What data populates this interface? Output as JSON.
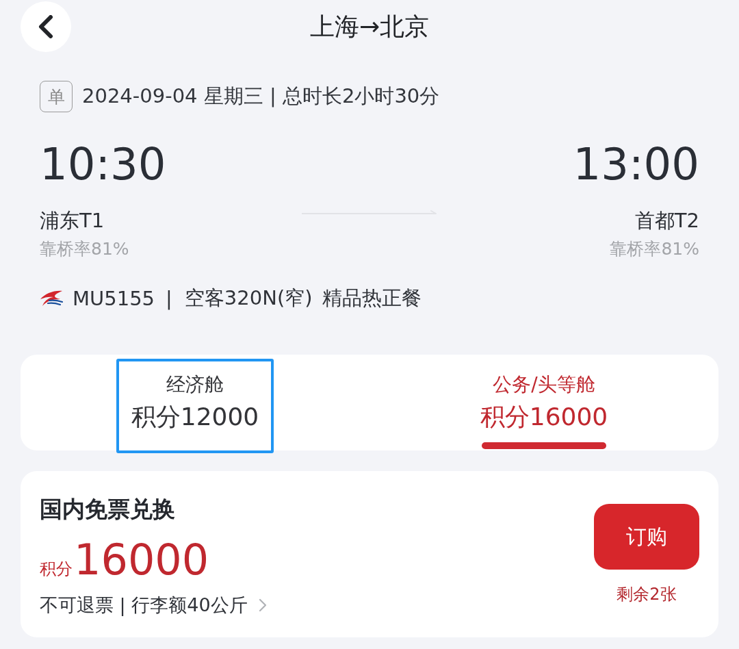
{
  "header": {
    "title": "上海→北京"
  },
  "flight": {
    "trip_badge": "单",
    "date_line": "2024-09-04 星期三 | 总时长2小时30分",
    "departure": {
      "time": "10:30",
      "airport": "浦东T1",
      "bridge_rate": "靠桥率81%"
    },
    "arrival": {
      "time": "13:00",
      "airport": "首都T2",
      "bridge_rate": "靠桥率81%"
    },
    "flight_number": "MU5155",
    "separator": "|",
    "aircraft": "空客320N(窄)",
    "meal": "精品热正餐"
  },
  "cabin_tabs": [
    {
      "name": "经济舱",
      "points": "积分12000",
      "selected": false,
      "highlighted": true
    },
    {
      "name": "公务/头等舱",
      "points": "积分16000",
      "selected": true,
      "highlighted": false
    }
  ],
  "offer": {
    "title": "国内免票兑换",
    "points_label": "积分",
    "points": "16000",
    "terms": "不可退票 | 行李额40公斤",
    "button": "订购",
    "remaining": "剩余2张"
  }
}
